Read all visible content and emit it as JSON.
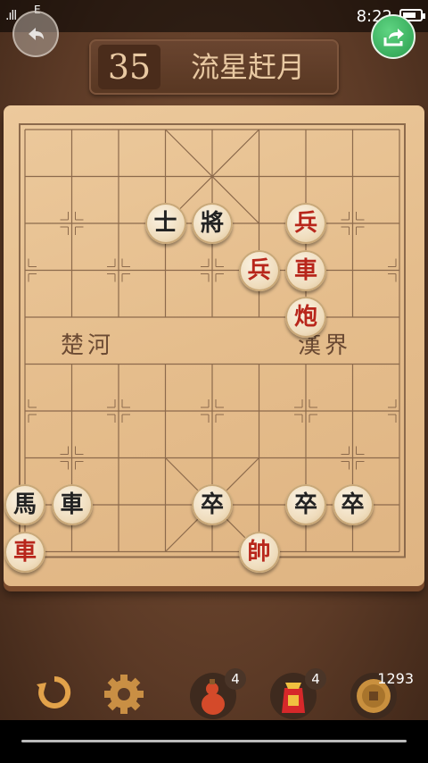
{
  "status_bar": {
    "signal": ".ıll",
    "network": "E",
    "time": "8:22"
  },
  "header": {
    "level_number": "35",
    "level_name": "流星赶月"
  },
  "board": {
    "river_left": "楚河",
    "river_right": "漢界",
    "pieces": [
      {
        "char": "士",
        "side": "black",
        "col": 3,
        "row": 2
      },
      {
        "char": "將",
        "side": "black",
        "col": 4,
        "row": 2
      },
      {
        "char": "兵",
        "side": "red",
        "col": 6,
        "row": 2
      },
      {
        "char": "兵",
        "side": "red",
        "col": 5,
        "row": 3
      },
      {
        "char": "車",
        "side": "red",
        "col": 6,
        "row": 3
      },
      {
        "char": "炮",
        "side": "red",
        "col": 6,
        "row": 4
      },
      {
        "char": "馬",
        "side": "black",
        "col": 0,
        "row": 8
      },
      {
        "char": "車",
        "side": "black",
        "col": 1,
        "row": 8
      },
      {
        "char": "卒",
        "side": "black",
        "col": 4,
        "row": 8
      },
      {
        "char": "卒",
        "side": "black",
        "col": 6,
        "row": 8
      },
      {
        "char": "卒",
        "side": "black",
        "col": 7,
        "row": 8
      },
      {
        "char": "車",
        "side": "red",
        "col": 0,
        "row": 9
      },
      {
        "char": "帥",
        "side": "red",
        "col": 5,
        "row": 9
      }
    ]
  },
  "toolbar": {
    "undo_icon": "undo-icon",
    "settings_icon": "gear-icon",
    "gourd_count": "4",
    "hint_bag_count": "4",
    "coins": "1293"
  }
}
